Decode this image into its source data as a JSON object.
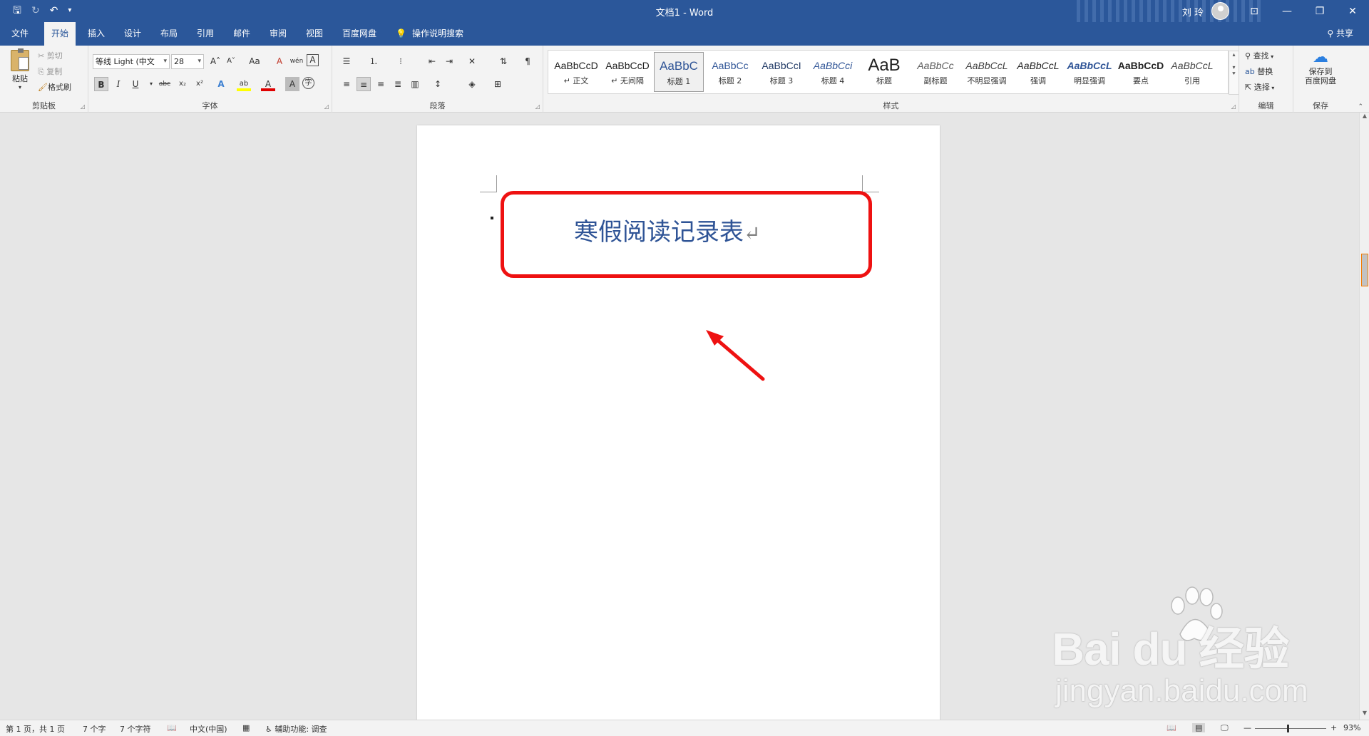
{
  "window": {
    "title": "文档1  -  Word",
    "user": "刘 玲",
    "qat": {
      "save": "🖫",
      "redo": "↻",
      "undo": "↶",
      "more": "▾"
    },
    "controls": {
      "ribbon_display": "⊡",
      "minimize": "—",
      "restore": "❐",
      "close": "✕"
    }
  },
  "tabs": [
    "文件",
    "开始",
    "插入",
    "设计",
    "布局",
    "引用",
    "邮件",
    "审阅",
    "视图",
    "百度网盘"
  ],
  "active_tab": "开始",
  "tell_me": "操作说明搜索",
  "share": "共享",
  "clipboard": {
    "paste": "粘贴",
    "cut": "剪切",
    "copy": "复制",
    "format_painter": "格式刷",
    "label": "剪贴板"
  },
  "font": {
    "name": "等线 Light (中文",
    "size": "28",
    "label": "字体",
    "bold": "B",
    "italic": "I",
    "underline": "U",
    "strike": "abc",
    "sub": "x₂",
    "sup": "x²",
    "grow": "A˄",
    "shrink": "A˅",
    "case": "Aa",
    "clear": "A",
    "phonetic": "wén",
    "border": "A",
    "effects": "A",
    "highlight": "ab",
    "color": "A",
    "shading": "A",
    "enclose": "字"
  },
  "paragraph": {
    "label": "段落"
  },
  "styles": {
    "label": "样式",
    "items": [
      {
        "sample": "AaBbCcD",
        "name": "↵ 正文",
        "color": "#222222"
      },
      {
        "sample": "AaBbCcD",
        "name": "↵ 无间隔",
        "color": "#222222"
      },
      {
        "sample": "AaBbC",
        "name": "标题 1",
        "color": "#2f5496"
      },
      {
        "sample": "AaBbCc",
        "name": "标题 2",
        "color": "#2f5496"
      },
      {
        "sample": "AaBbCcI",
        "name": "标题 3",
        "color": "#1f3864"
      },
      {
        "sample": "AaBbCci",
        "name": "标题 4",
        "color": "#2f5496"
      },
      {
        "sample": "AaB",
        "name": "标题",
        "color": "#222222"
      },
      {
        "sample": "AaBbCc",
        "name": "副标题",
        "color": "#5a5a5a"
      },
      {
        "sample": "AaBbCcL",
        "name": "不明显强调",
        "color": "#404040"
      },
      {
        "sample": "AaBbCcL",
        "name": "强调",
        "color": "#222222"
      },
      {
        "sample": "AaBbCcL",
        "name": "明显强调",
        "color": "#2f5496"
      },
      {
        "sample": "AaBbCcD",
        "name": "要点",
        "color": "#222222"
      },
      {
        "sample": "AaBbCcL",
        "name": "引用",
        "color": "#404040"
      }
    ]
  },
  "editing": {
    "find": "查找",
    "replace": "替换",
    "select": "选择",
    "label": "编辑"
  },
  "save_group": {
    "button": "保存到\n百度网盘",
    "line1": "保存到",
    "line2": "百度网盘",
    "label": "保存"
  },
  "document": {
    "heading": "寒假阅读记录表",
    "para_mark": "↵"
  },
  "status": {
    "page": "第 1 页，共 1 页",
    "words": "7 个字",
    "chars": "7 个字符",
    "language": "中文(中国)",
    "accessibility": "辅助功能: 调查",
    "zoom": "93%",
    "zoom_minus": "—",
    "zoom_plus": "+"
  },
  "watermark": {
    "main": "Bai du 经验",
    "sub": "jingyan.baidu.com"
  },
  "colors": {
    "brand": "#2b579a",
    "heading": "#2f5496",
    "annotation": "#ee1111"
  }
}
